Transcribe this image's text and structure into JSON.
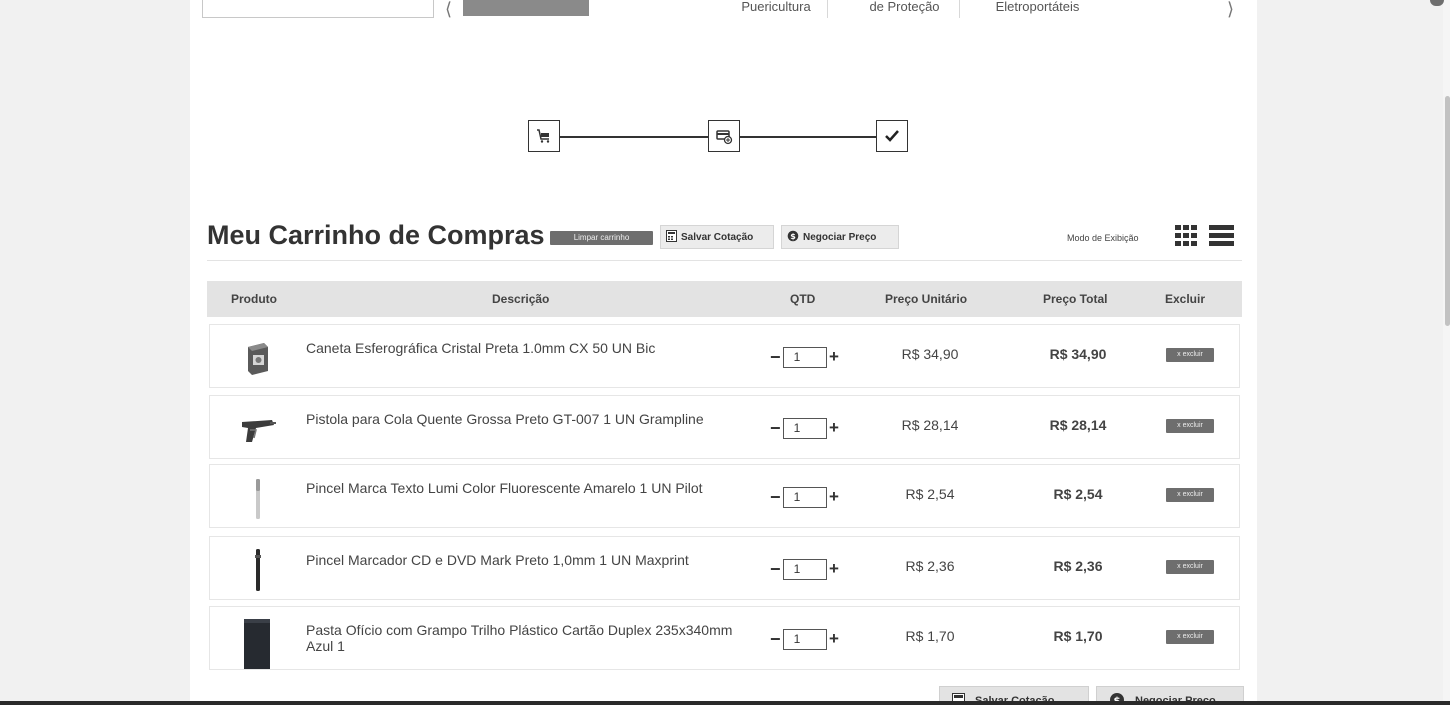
{
  "top_nav": {
    "categories": [
      "Puericultura",
      "de Proteção",
      "Eletroportáteis"
    ]
  },
  "steps": [
    {
      "icon": "cart-icon",
      "state": "current"
    },
    {
      "icon": "payment-card-icon",
      "state": "pending"
    },
    {
      "icon": "checkmark-icon",
      "state": "pending"
    }
  ],
  "cart": {
    "title": "Meu Carrinho de Compras",
    "clear_label": "Limpar carrinho",
    "save_quote_label": "Salvar Cotação",
    "negotiate_label": "Negociar Preço",
    "view_mode_label": "Modo de Exibição"
  },
  "table": {
    "headers": {
      "product": "Produto",
      "description": "Descrição",
      "qty": "QTD",
      "unit_price": "Preço Unitário",
      "total_price": "Preço Total",
      "remove": "Excluir"
    },
    "rows": [
      {
        "description": "Caneta Esferográfica Cristal Preta 1.0mm CX 50 UN Bic",
        "qty": "1",
        "unit_price": "R$ 34,90",
        "total_price": "R$ 34,90",
        "remove_label": "x excluir",
        "thumb": "pen-box"
      },
      {
        "description": "Pistola para Cola Quente Grossa Preto GT-007 1 UN Grampline",
        "qty": "1",
        "unit_price": "R$ 28,14",
        "total_price": "R$ 28,14",
        "remove_label": "x excluir",
        "thumb": "glue-gun"
      },
      {
        "description": "Pincel Marca Texto Lumi Color Fluorescente Amarelo 1 UN Pilot",
        "qty": "1",
        "unit_price": "R$ 2,54",
        "total_price": "R$ 2,54",
        "remove_label": "x excluir",
        "thumb": "highlighter"
      },
      {
        "description": "Pincel Marcador CD e DVD Mark Preto 1,0mm 1 UN Maxprint",
        "qty": "1",
        "unit_price": "R$ 2,36",
        "total_price": "R$ 2,36",
        "remove_label": "x excluir",
        "thumb": "marker"
      },
      {
        "description": "Pasta Ofício com Grampo Trilho Plástico Cartão Duplex 235x340mm Azul 1",
        "qty": "1",
        "unit_price": "R$ 1,70",
        "total_price": "R$ 1,70",
        "remove_label": "x excluir",
        "thumb": "folder"
      }
    ]
  },
  "bottom": {
    "save_quote_label": "Salvar Cotação",
    "negotiate_label": "Negociar Preço"
  },
  "qty_controls": {
    "minus": "−",
    "plus": "+"
  },
  "colors": {
    "button_dark": "#6e6e6e",
    "header_bg": "#e3e3e3",
    "page_bg": "#ffffff"
  }
}
